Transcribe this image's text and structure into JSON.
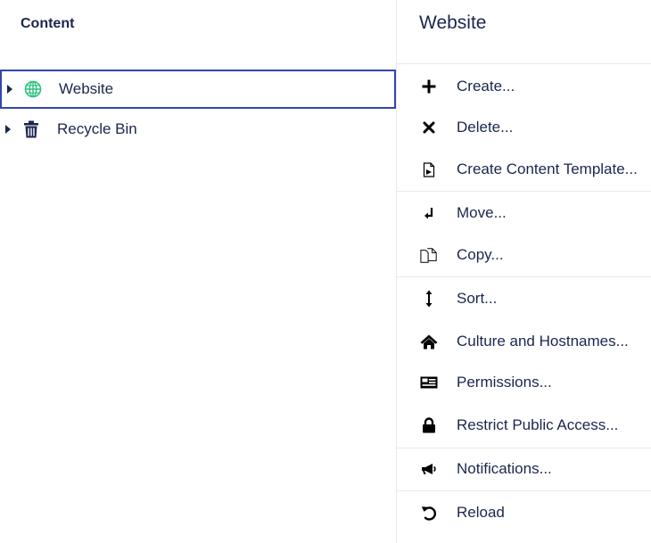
{
  "tree": {
    "header": "Content",
    "items": [
      {
        "label": "Website",
        "icon": "globe-icon",
        "selected": true,
        "icon_color": "#2bc37c"
      },
      {
        "label": "Recycle Bin",
        "icon": "trash-icon",
        "selected": false,
        "icon_color": "#1b264f"
      }
    ]
  },
  "menu": {
    "title": "Website",
    "items": [
      {
        "label": "Create...",
        "icon": "plus-icon"
      },
      {
        "label": "Delete...",
        "icon": "close-icon"
      },
      {
        "label": "Create Content Template...",
        "icon": "document-template-icon"
      },
      {
        "label": "Move...",
        "icon": "move-arrow-icon"
      },
      {
        "label": "Copy...",
        "icon": "copy-icon"
      },
      {
        "label": "Sort...",
        "icon": "sort-icon"
      },
      {
        "label": "Culture and Hostnames...",
        "icon": "home-icon"
      },
      {
        "label": "Permissions...",
        "icon": "permissions-card-icon"
      },
      {
        "label": "Restrict Public Access...",
        "icon": "lock-icon"
      },
      {
        "label": "Notifications...",
        "icon": "megaphone-icon"
      },
      {
        "label": "Reload",
        "icon": "reload-icon"
      }
    ]
  },
  "colors": {
    "text": "#1b264f",
    "selection_border": "#3544b1",
    "divider": "#e9e9eb",
    "globe": "#2bc37c"
  }
}
